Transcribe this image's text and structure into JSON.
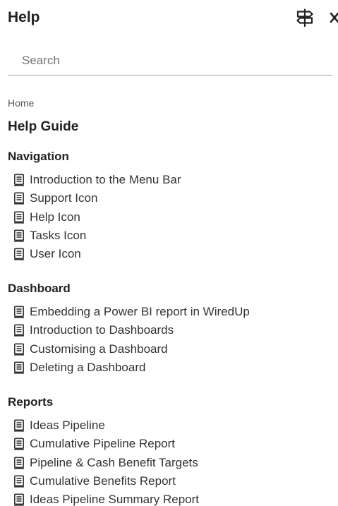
{
  "header": {
    "title": "Help"
  },
  "search": {
    "placeholder": "Search",
    "value": ""
  },
  "breadcrumb": {
    "home": "Home"
  },
  "guide": {
    "title": "Help Guide"
  },
  "sections": [
    {
      "heading": "Navigation",
      "items": [
        "Introduction to the Menu Bar",
        "Support Icon",
        "Help Icon",
        "Tasks Icon",
        "User Icon"
      ]
    },
    {
      "heading": "Dashboard",
      "items": [
        "Embedding a Power BI report in WiredUp",
        "Introduction to Dashboards",
        "Customising a Dashboard",
        "Deleting a Dashboard"
      ]
    },
    {
      "heading": "Reports",
      "items": [
        "Ideas Pipeline",
        "Cumulative Pipeline Report",
        "Pipeline & Cash Benefit Targets",
        "Cumulative Benefits Report",
        "Ideas Pipeline Summary Report"
      ]
    }
  ],
  "icons": {
    "header_left": "signpost-icon",
    "header_right": "close-icon",
    "article": "article-icon"
  },
  "colors": {
    "text": "#222222",
    "muted": "#757575",
    "divider": "#9e9e9e",
    "background": "#ffffff"
  }
}
